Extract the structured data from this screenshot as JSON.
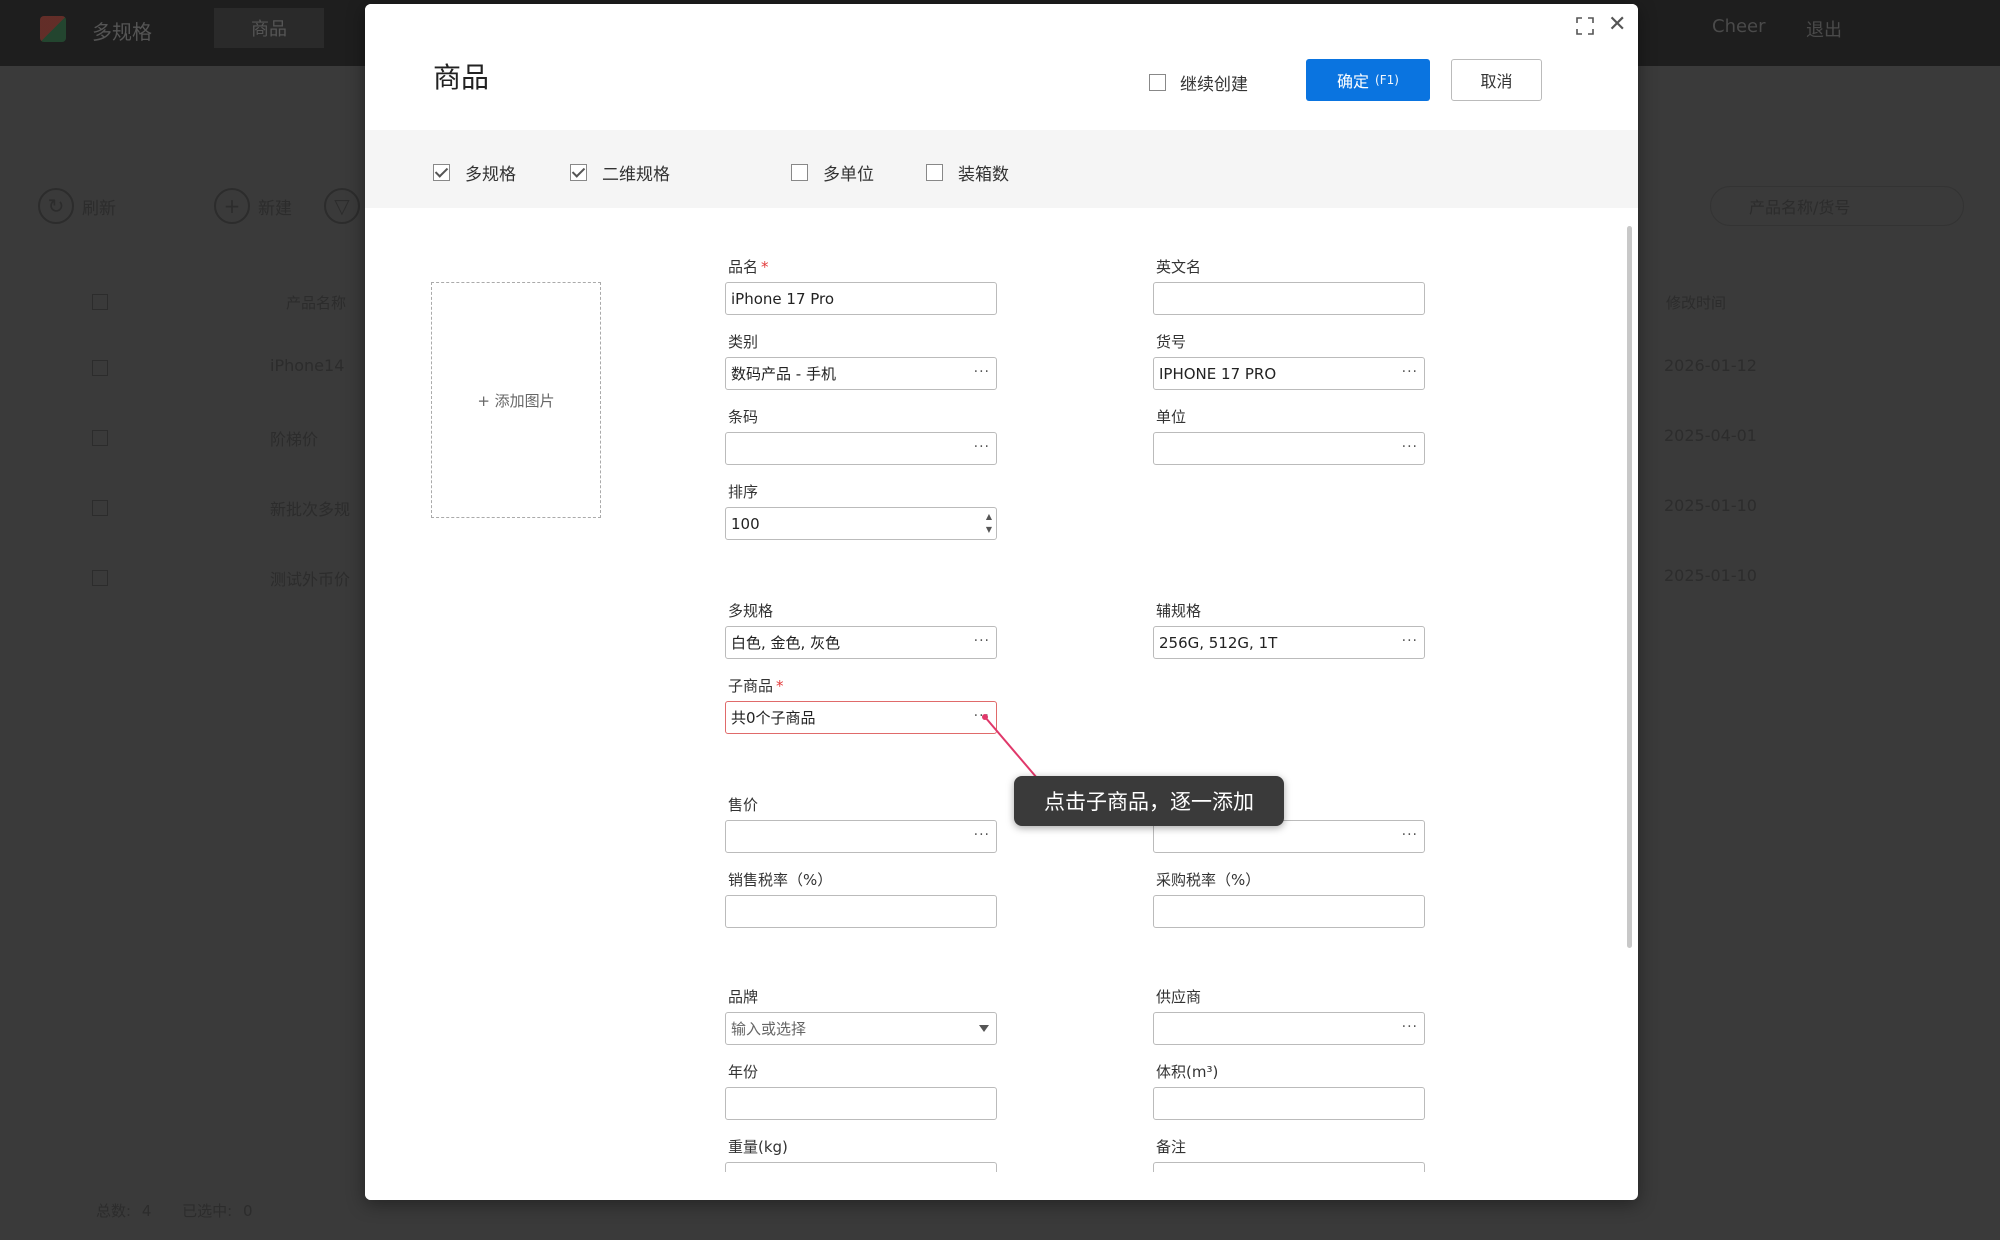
{
  "background": {
    "app_title": "多规格",
    "active_tab": "商品",
    "top_right": [
      "Cheer",
      "退出"
    ],
    "toolbar": {
      "refresh": "刷新",
      "new": "新建"
    },
    "search_placeholder": "产品名称/货号",
    "columns": {
      "name": "产品名称",
      "modified": "修改时间"
    },
    "rows": [
      {
        "name": "iPhone14",
        "date": "2026-01-12"
      },
      {
        "name": "阶梯价",
        "date": "2025-04-01"
      },
      {
        "name": "新批次多规",
        "date": "2025-01-10"
      },
      {
        "name": "测试外币价",
        "date": "2025-01-10"
      }
    ],
    "footer": {
      "total_label": "总数:",
      "total": "4",
      "selected_label": "已选中:",
      "selected": "0"
    }
  },
  "modal": {
    "title": "商品",
    "continue_create": "继续创建",
    "confirm": "确定",
    "confirm_hotkey": "(F1)",
    "cancel": "取消",
    "options": [
      {
        "label": "多规格",
        "checked": true
      },
      {
        "label": "二维规格",
        "checked": true
      },
      {
        "label": "多单位",
        "checked": false
      },
      {
        "label": "装箱数",
        "checked": false
      }
    ],
    "add_image": "+ 添加图片",
    "fields": {
      "name": {
        "label": "品名",
        "value": "iPhone 17 Pro"
      },
      "english_name": {
        "label": "英文名",
        "value": ""
      },
      "category": {
        "label": "类别",
        "value": "数码产品 - 手机"
      },
      "sku": {
        "label": "货号",
        "value": "IPHONE 17 PRO"
      },
      "barcode": {
        "label": "条码",
        "value": ""
      },
      "unit": {
        "label": "单位",
        "value": ""
      },
      "sort": {
        "label": "排序",
        "value": "100"
      },
      "multi_spec": {
        "label": "多规格",
        "value": "白色, 金色, 灰色"
      },
      "aux_spec": {
        "label": "辅规格",
        "value": "256G, 512G, 1T"
      },
      "sub_goods": {
        "label": "子商品",
        "value": "共0个子商品"
      },
      "price": {
        "label": "售价",
        "value": ""
      },
      "purchase_price": {
        "value": ""
      },
      "sales_tax": {
        "label": "销售税率（%）",
        "value": ""
      },
      "purchase_tax": {
        "label": "采购税率（%）",
        "value": ""
      },
      "brand": {
        "label": "品牌",
        "placeholder": "输入或选择"
      },
      "supplier": {
        "label": "供应商",
        "value": ""
      },
      "year": {
        "label": "年份",
        "value": ""
      },
      "volume": {
        "label": "体积(m³)",
        "value": ""
      },
      "weight": {
        "label": "重量(kg)",
        "value": ""
      },
      "remark": {
        "label": "备注",
        "value": ""
      }
    },
    "tooltip": "点击子商品，逐一添加"
  },
  "colors": {
    "primary": "#0a74e0",
    "required": "#e23b3b",
    "pointer": "#e0386a",
    "tooltip_bg": "#3a3a3a"
  }
}
